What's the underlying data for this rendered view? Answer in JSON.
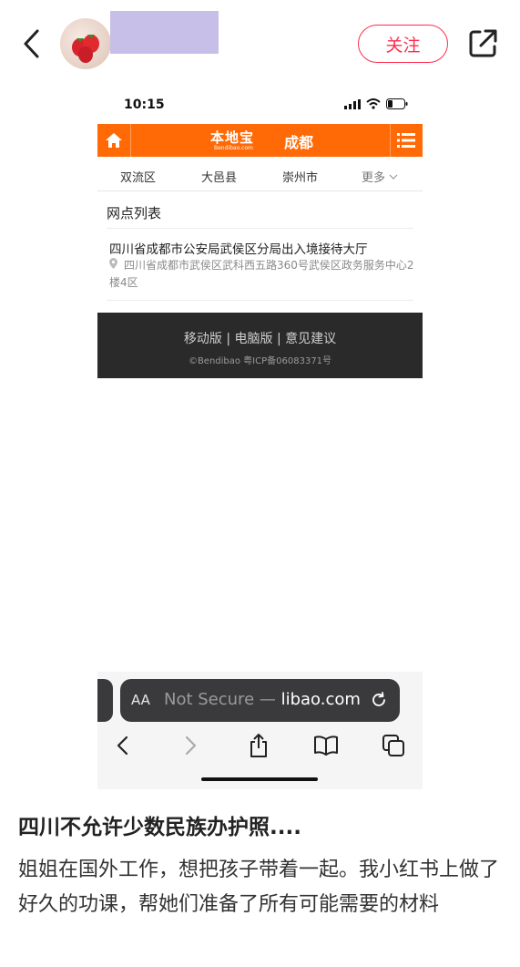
{
  "header": {
    "follow_label": "关注"
  },
  "phone": {
    "status_time": "10:15",
    "site": {
      "logo_text": "本地宝",
      "logo_sub": "Bendibao.com",
      "city": "成都",
      "districts": [
        "双流区",
        "大邑县",
        "崇州市"
      ],
      "more_label": "更多",
      "list_title": "网点列表",
      "item": {
        "title": "四川省成都市公安局武侯区分局出入境接待大厅",
        "address": "四川省成都市武侯区武科西五路360号武侯区政务服务中心2楼4区"
      },
      "footer_links": "移动版 | 电脑版 | 意见建议",
      "footer_copy": "©Bendibao 粤ICP备06083371号"
    },
    "safari": {
      "aa_label": "AA",
      "url_dim": "Not Secure — ",
      "url_host": "libao.com"
    }
  },
  "post": {
    "title": "四川不允许少数民族办护照....",
    "body": "姐姐在国外工作，想把孩子带着一起。我小红书上做了好久的功课，帮她们准备了所有可能需要的材料"
  },
  "colors": {
    "accent": "#ff2e4d",
    "site_orange": "#ff6a06",
    "footer_bg": "#2a2a2a"
  }
}
